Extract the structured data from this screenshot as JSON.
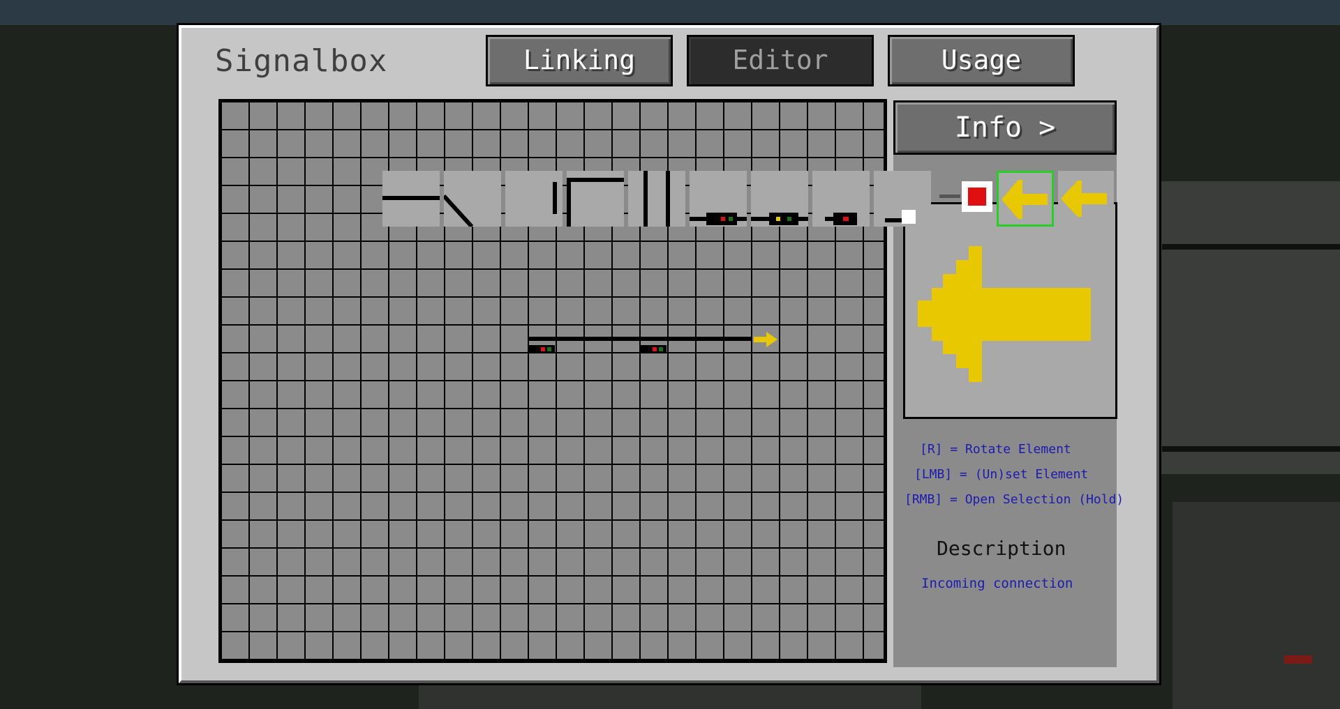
{
  "window": {
    "title": "Signalbox"
  },
  "tabs": [
    {
      "label": "Linking",
      "active": false
    },
    {
      "label": "Editor",
      "active": true
    },
    {
      "label": "Usage",
      "active": false
    }
  ],
  "info_button": {
    "label": "Info >"
  },
  "palette": [
    {
      "icon": "straight-track-icon"
    },
    {
      "icon": "diagonal-track-icon"
    },
    {
      "icon": "end-track-icon"
    },
    {
      "icon": "corner-track-icon"
    },
    {
      "icon": "double-track-icon"
    },
    {
      "icon": "main-signal-icon"
    },
    {
      "icon": "distant-signal-icon"
    },
    {
      "icon": "shunt-signal-icon"
    },
    {
      "icon": "bufferstop-icon"
    },
    {
      "icon": "stop-marker-icon"
    },
    {
      "icon": "incoming-connection-icon",
      "selected": true
    },
    {
      "icon": "outgoing-connection-icon"
    }
  ],
  "hints": [
    "[R] = Rotate Element",
    "[LMB] = (Un)set Element",
    "[RMB] = Open Selection (Hold)"
  ],
  "description": {
    "title": "Description",
    "text": "Incoming connection"
  },
  "colors": {
    "arrow": "#e8c800",
    "selection": "#24d024",
    "hint_text": "#1b1bb0",
    "signal_red": "#e01010",
    "signal_green": "#1a6e1a",
    "signal_yellow": "#e8c800"
  }
}
